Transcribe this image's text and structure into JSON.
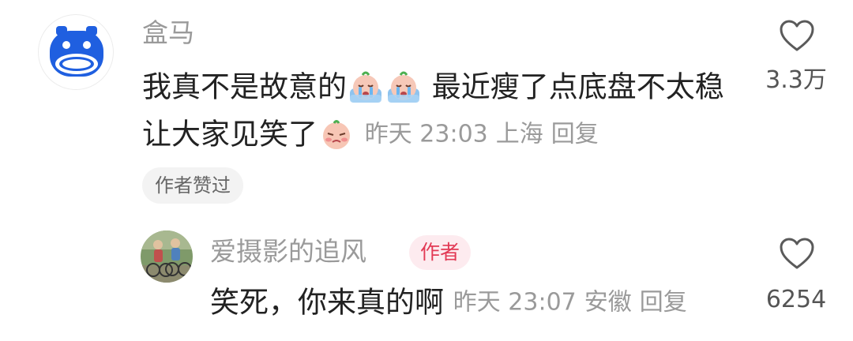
{
  "comment": {
    "username": "盒马",
    "text_part1": "我真不是故意的",
    "emoji_1": "crying-face-emoji",
    "emoji_2": "crying-face-emoji",
    "text_part2": "最近瘦了点底盘不太稳 让大家见笑了",
    "emoji_3": "embarrassed-face-emoji",
    "time": "昨天 23:03",
    "location": "上海",
    "reply_label": "回复",
    "author_liked_label": "作者赞过",
    "like_count": "3.3万",
    "avatar_icon": "hippo-logo-icon",
    "like_icon": "heart-icon"
  },
  "reply": {
    "username": "爱摄影的追风",
    "author_badge": "作者",
    "text": "笑死，你来真的啊",
    "time": "昨天 23:07",
    "location": "安徽",
    "reply_label": "回复",
    "like_count": "6254",
    "avatar_icon": "cyclists-photo-avatar",
    "like_icon": "heart-icon"
  },
  "colors": {
    "brand_blue": "#1f5fe0",
    "secondary_text": "#9a9a9a",
    "badge_text": "#e23a55",
    "badge_bg": "#fdebef"
  }
}
